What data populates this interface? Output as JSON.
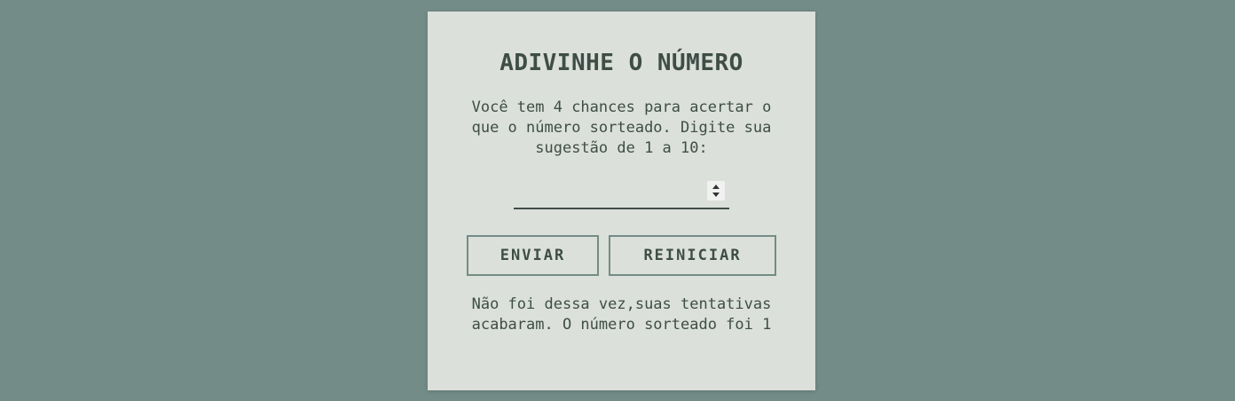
{
  "game": {
    "title": "ADIVINHE O NÚMERO",
    "instructions": "Você tem 4 chances para acertar o que o número sorteado. Digite sua sugestão de 1 a 10:",
    "guess_input": {
      "value": "",
      "placeholder": ""
    },
    "send_label": "ENVIAR",
    "restart_label": "REINICIAR",
    "result_message": "Não foi dessa vez,suas tentativas acabaram. O número sorteado foi 1"
  },
  "colors": {
    "background": "#738c87",
    "card": "#dbe0da",
    "text": "#3f4d47",
    "button_border": "#738c87"
  },
  "icons": {
    "spinner": "up-down-spinner-icon"
  }
}
